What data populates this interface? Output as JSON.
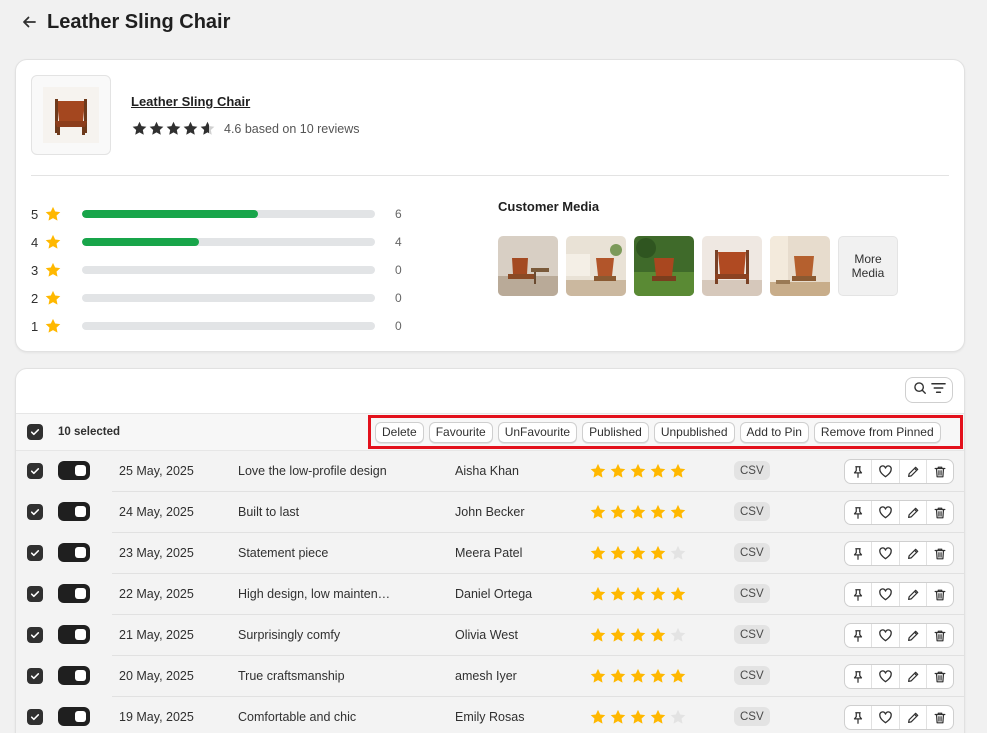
{
  "page": {
    "title": "Leather Sling Chair"
  },
  "product": {
    "name": "Leather Sling Chair",
    "rating_value": 4.6,
    "rating_text": "4.6 based on 10 reviews"
  },
  "distribution": [
    {
      "label": "5",
      "count": "6",
      "fraction": 0.6
    },
    {
      "label": "4",
      "count": "4",
      "fraction": 0.4
    },
    {
      "label": "3",
      "count": "0",
      "fraction": 0
    },
    {
      "label": "2",
      "count": "0",
      "fraction": 0
    },
    {
      "label": "1",
      "count": "0",
      "fraction": 0
    }
  ],
  "media": {
    "title": "Customer Media",
    "more_label": "More Media"
  },
  "bulk": {
    "selected_text": "10 selected",
    "actions": [
      "Delete",
      "Favourite",
      "UnFavourite",
      "Published",
      "Unpublished",
      "Add to Pin",
      "Remove from Pinned"
    ]
  },
  "reviews": [
    {
      "date": "25 May, 2025",
      "title": "Love the low-profile design",
      "author": "Aisha Khan",
      "stars": 5,
      "source": "CSV"
    },
    {
      "date": "24 May, 2025",
      "title": "Built to last",
      "author": "John Becker",
      "stars": 5,
      "source": "CSV"
    },
    {
      "date": "23 May, 2025",
      "title": "Statement piece",
      "author": "Meera Patel",
      "stars": 4,
      "source": "CSV"
    },
    {
      "date": "22 May, 2025",
      "title": "High design, low maintenance",
      "author": "Daniel Ortega",
      "stars": 5,
      "source": "CSV"
    },
    {
      "date": "21 May, 2025",
      "title": "Surprisingly comfy",
      "author": "Olivia West",
      "stars": 4,
      "source": "CSV"
    },
    {
      "date": "20 May, 2025",
      "title": "True craftsmanship",
      "author": "amesh Iyer",
      "stars": 5,
      "source": "CSV"
    },
    {
      "date": "19 May, 2025",
      "title": "Comfortable and chic",
      "author": "Emily Rosas",
      "stars": 4,
      "source": "CSV"
    }
  ],
  "colors": {
    "star_filled": "#ffb800",
    "star_empty": "#e3e3e3",
    "bar_fill": "#18a54a",
    "highlight": "#e3111c"
  }
}
